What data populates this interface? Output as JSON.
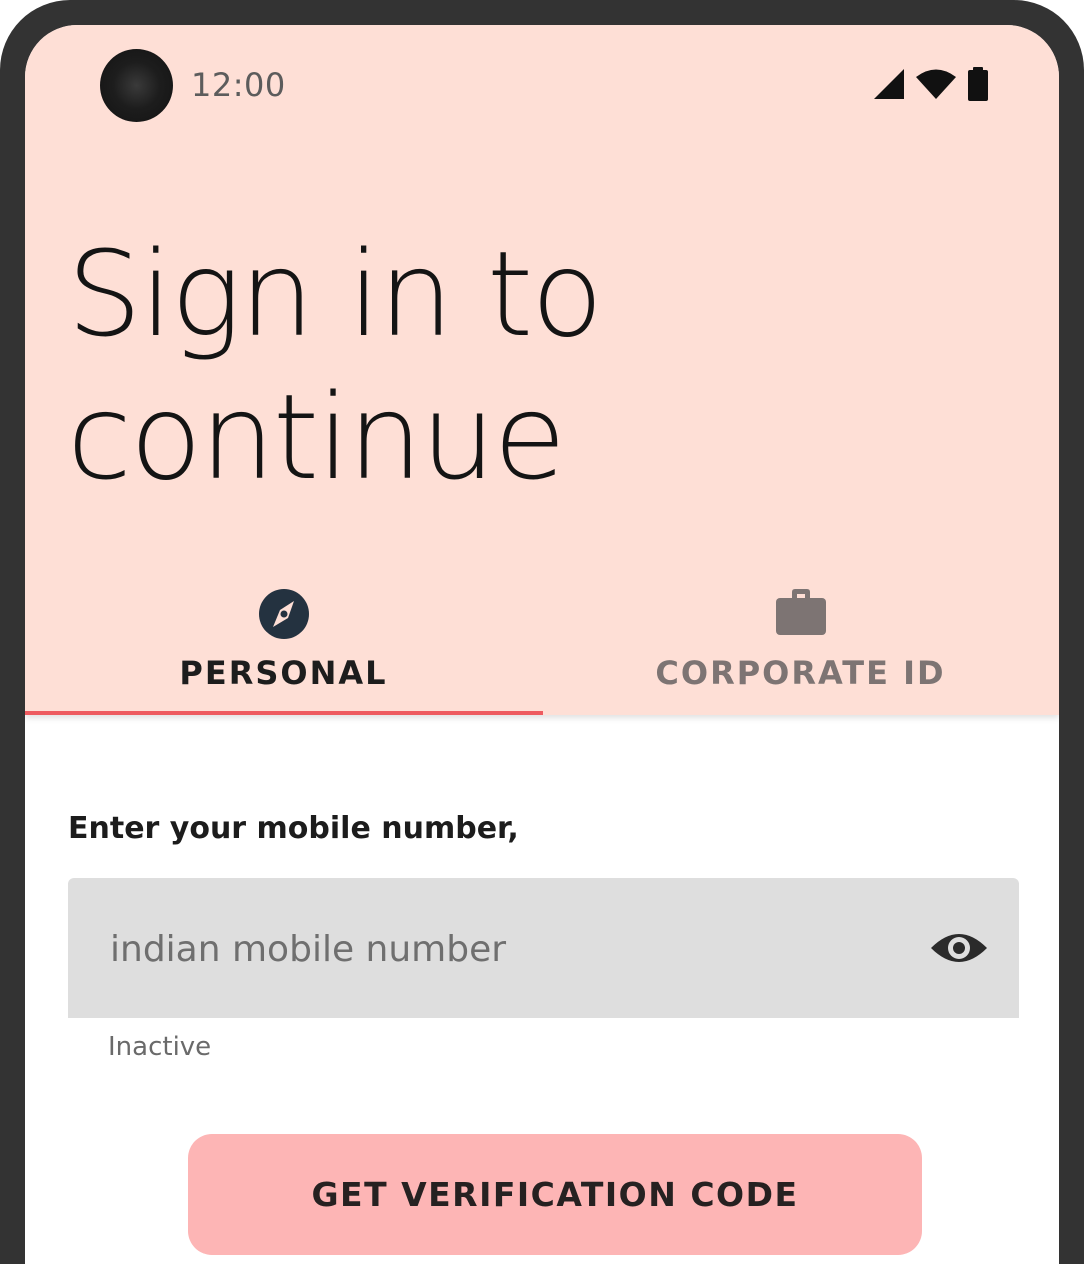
{
  "status_bar": {
    "time": "12:00",
    "icons": [
      "cellular-signal-icon",
      "wifi-icon",
      "battery-icon"
    ]
  },
  "header": {
    "title": "Sign in to continue",
    "background": "#fedfd6"
  },
  "tabs": [
    {
      "label": "PERSONAL",
      "icon": "compass-icon",
      "active": true
    },
    {
      "label": "CORPORATE ID",
      "icon": "briefcase-icon",
      "active": false
    }
  ],
  "form": {
    "prompt": "Enter your mobile number,",
    "mobile_input": {
      "value": "",
      "placeholder": "indian mobile number",
      "trailing_icon": "eye-icon"
    },
    "helper_text": "Inactive"
  },
  "cta": {
    "label": "GET VERIFICATION CODE",
    "color": "#fdb5b5"
  },
  "colors": {
    "accent": "#ee5b60",
    "frame": "#333333"
  }
}
